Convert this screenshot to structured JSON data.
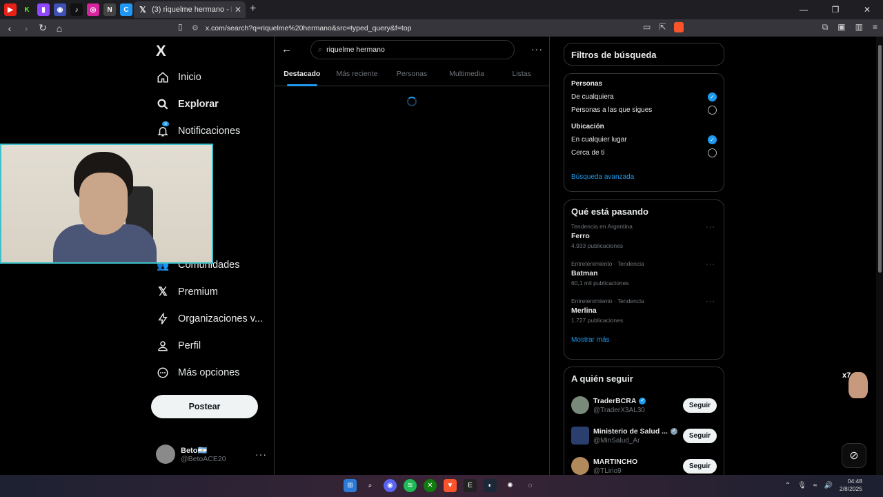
{
  "browser": {
    "tab_title": "(3) riquelme hermano - Buscar /",
    "url": "x.com/search?q=riquelme%20hermano&src=typed_query&f=top"
  },
  "nav": {
    "logo": "X",
    "items": [
      {
        "label": "Inicio",
        "icon": "home-icon"
      },
      {
        "label": "Explorar",
        "icon": "search-icon"
      },
      {
        "label": "Notificaciones",
        "icon": "bell-icon"
      },
      {
        "label": "Comunidades",
        "icon": "communities-icon"
      },
      {
        "label": "Premium",
        "icon": "x-icon"
      },
      {
        "label": "Organizaciones v...",
        "icon": "bolt-icon"
      },
      {
        "label": "Perfil",
        "icon": "person-icon"
      },
      {
        "label": "Más opciones",
        "icon": "more-circle-icon"
      }
    ],
    "notif_badge": "3",
    "post_button": "Postear",
    "profile": {
      "name": "Beto",
      "flag": "🇦🇷",
      "handle": "@BetoACE20"
    }
  },
  "search": {
    "query": "riquelme hermano",
    "tabs": [
      "Destacado",
      "Más reciente",
      "Personas",
      "Multimedia",
      "Listas"
    ],
    "active_tab": "Destacado"
  },
  "filters": {
    "title": "Filtros de búsqueda",
    "personas_label": "Personas",
    "personas_options": [
      {
        "label": "De cualquiera",
        "checked": true
      },
      {
        "label": "Personas a las que sigues",
        "checked": false
      }
    ],
    "ubicacion_label": "Ubicación",
    "ubicacion_options": [
      {
        "label": "En cualquier lugar",
        "checked": true
      },
      {
        "label": "Cerca de ti",
        "checked": false
      }
    ],
    "advanced": "Búsqueda avanzada"
  },
  "trends": {
    "title": "Qué está pasando",
    "items": [
      {
        "meta": "Tendencia en Argentina",
        "name": "Ferro",
        "count": "4.933 publicaciones"
      },
      {
        "meta": "Entretenimiento · Tendencia",
        "name": "Batman",
        "count": "60,1 mil publicaciones"
      },
      {
        "meta": "Entretenimiento · Tendencia",
        "name": "Merlina",
        "count": "1.727 publicaciones"
      }
    ],
    "show_more": "Mostrar más"
  },
  "who_to_follow": {
    "title": "A quién seguir",
    "items": [
      {
        "name": "TraderBCRA",
        "handle": "@TraderX3AL30",
        "button": "Seguir",
        "verified": "blue"
      },
      {
        "name": "Ministerio de Salud ...",
        "handle": "@MinSalud_Ar",
        "button": "Seguir",
        "verified": "gray"
      },
      {
        "name": "MARTINCHO",
        "handle": "@TLirio9",
        "button": "Seguir",
        "verified": "none"
      }
    ]
  },
  "floating": {
    "multiplier": "x7"
  },
  "taskbar": {
    "time": "04:48",
    "date": "2/8/2025"
  },
  "colors": {
    "accent": "#1d9bf0",
    "background": "#000000",
    "border": "#2f3336",
    "muted": "#71767b"
  }
}
